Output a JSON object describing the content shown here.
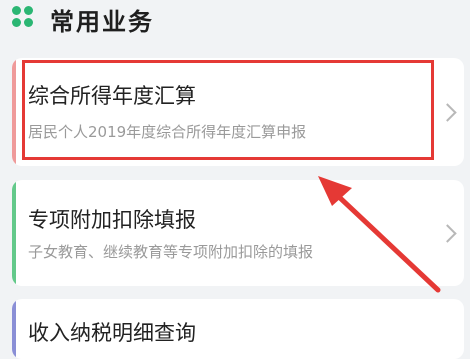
{
  "section": {
    "title": "常用业务",
    "icon": "four-dots-icon"
  },
  "cards": [
    {
      "title": "综合所得年度汇算",
      "subtitle": "居民个人2019年度综合所得年度汇算申报",
      "accent": "#ef9a9a"
    },
    {
      "title": "专项附加扣除填报",
      "subtitle": "子女教育、继续教育等专项附加扣除的填报",
      "accent": "#63c98a"
    },
    {
      "title": "收入纳税明细查询",
      "accent": "#8a8fd6"
    }
  ],
  "annotation": {
    "color": "#e53935"
  }
}
